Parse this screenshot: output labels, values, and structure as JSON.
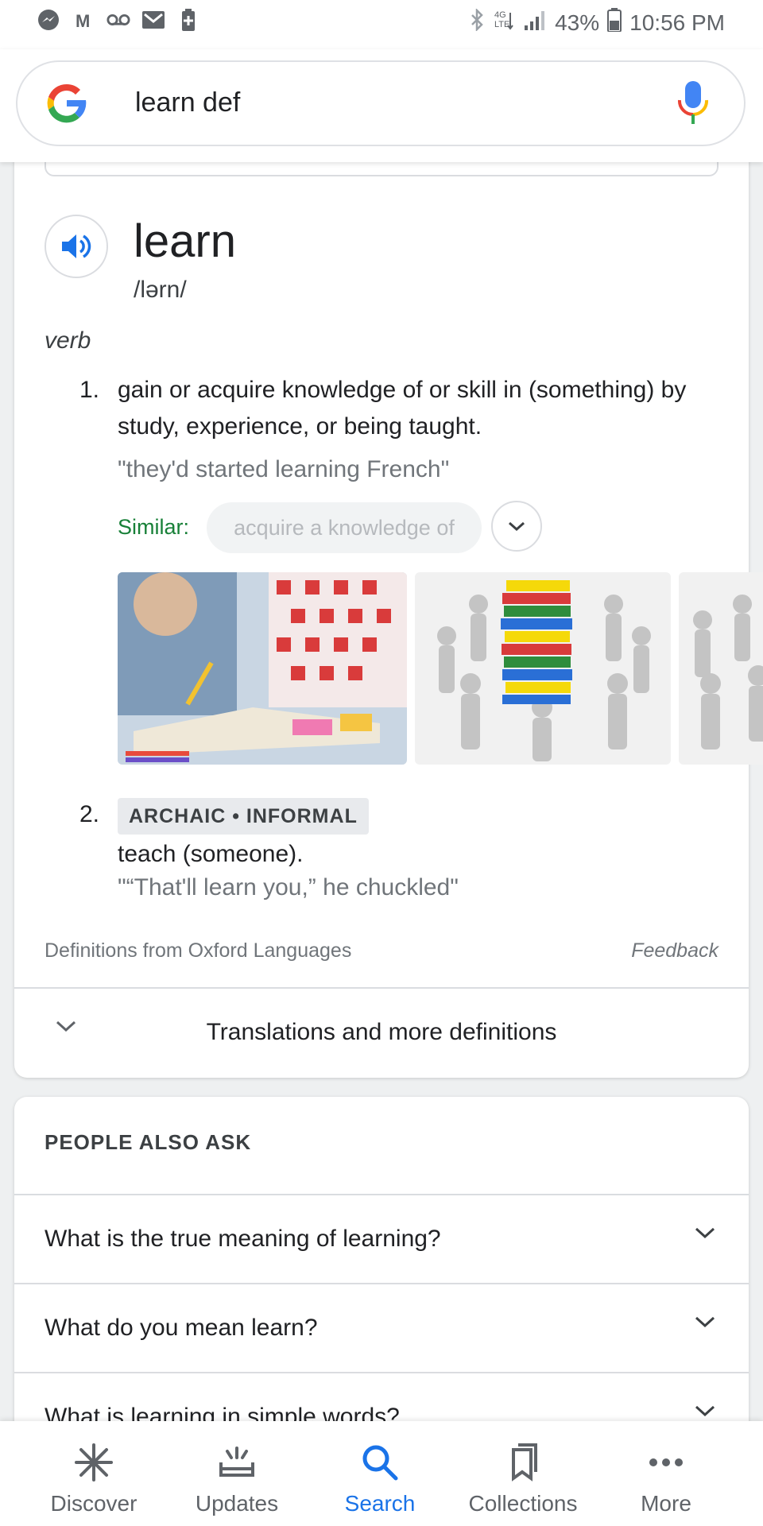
{
  "status_bar": {
    "battery": "43%",
    "time": "10:56 PM"
  },
  "search": {
    "query": "learn def"
  },
  "dictionary": {
    "word": "learn",
    "phonetic": "/lərn/",
    "part_of_speech": "verb",
    "definitions": [
      {
        "number": "1.",
        "text": "gain or acquire knowledge of or skill in (something) by study, experience, or being taught.",
        "example": "\"they'd started learning French\"",
        "similar_label": "Similar:",
        "similar_chip": "acquire a knowledge of"
      },
      {
        "number": "2.",
        "tag": "ARCHAIC • INFORMAL",
        "text": "teach (someone).",
        "example": "\"“That'll learn you,” he chuckled\""
      }
    ],
    "source": "Definitions from Oxford Languages",
    "feedback": "Feedback",
    "translations": "Translations and more definitions"
  },
  "people_also_ask": {
    "title": "PEOPLE ALSO ASK",
    "questions": [
      "What is the true meaning of learning?",
      "What do you mean learn?",
      "What is learning in simple words?"
    ]
  },
  "bottom_nav": {
    "discover": "Discover",
    "updates": "Updates",
    "search": "Search",
    "collections": "Collections",
    "more": "More"
  },
  "colors": {
    "accent": "#1a73e8",
    "similar_green": "#188038"
  }
}
